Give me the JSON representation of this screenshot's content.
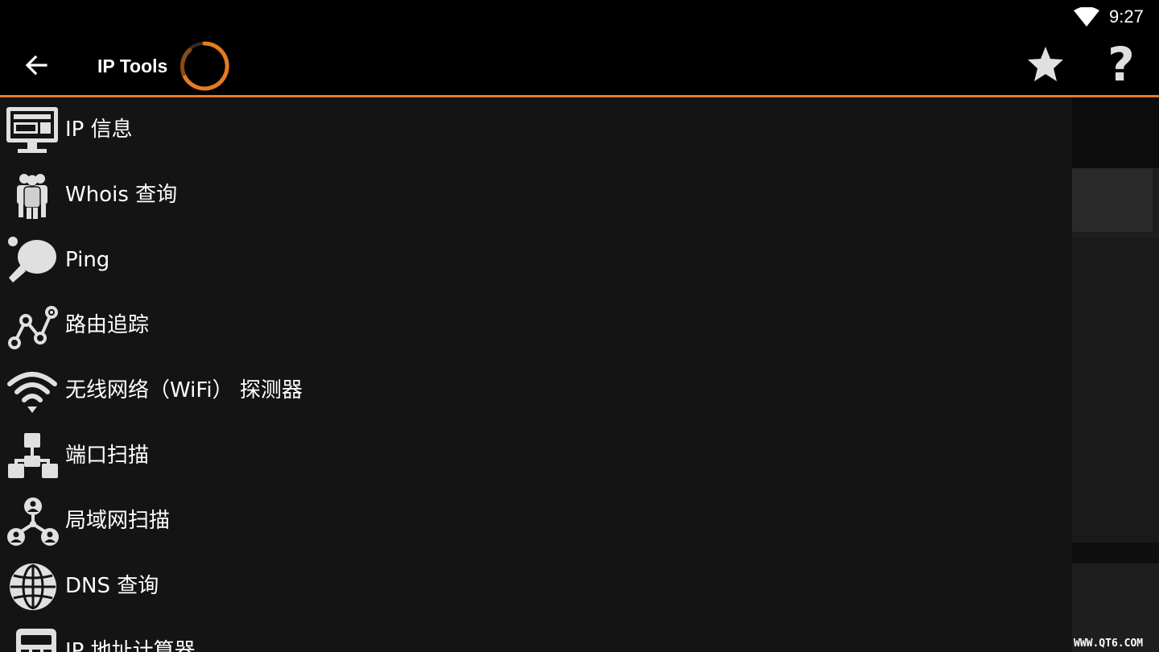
{
  "status_bar": {
    "time": "9:27",
    "wifi_icon": "wifi-icon"
  },
  "app_bar": {
    "title": "IP Tools",
    "back_icon": "arrow-back-icon",
    "spinner_icon": "loading-spinner-icon",
    "favorite_icon": "star-icon",
    "help_label": "?"
  },
  "colors": {
    "accent": "#e57c22",
    "background": "#000000",
    "drawer_background": "#141414",
    "text": "#ffffff",
    "icon": "#e0e0e0"
  },
  "drawer": {
    "items": [
      {
        "label": "IP 信息",
        "icon": "monitor-icon"
      },
      {
        "label": "Whois 查询",
        "icon": "people-group-icon"
      },
      {
        "label": "Ping",
        "icon": "ping-pong-icon"
      },
      {
        "label": "路由追踪",
        "icon": "route-trace-icon"
      },
      {
        "label": "无线网络（WiFi） 探测器",
        "icon": "wifi-signal-icon"
      },
      {
        "label": "端口扫描",
        "icon": "network-ports-icon"
      },
      {
        "label": "局域网扫描",
        "icon": "lan-users-icon"
      },
      {
        "label": "DNS 查询",
        "icon": "globe-icon"
      },
      {
        "label": "IP 地址计算器",
        "icon": "calculator-icon"
      }
    ]
  },
  "watermark": "WWW.QT6.COM"
}
